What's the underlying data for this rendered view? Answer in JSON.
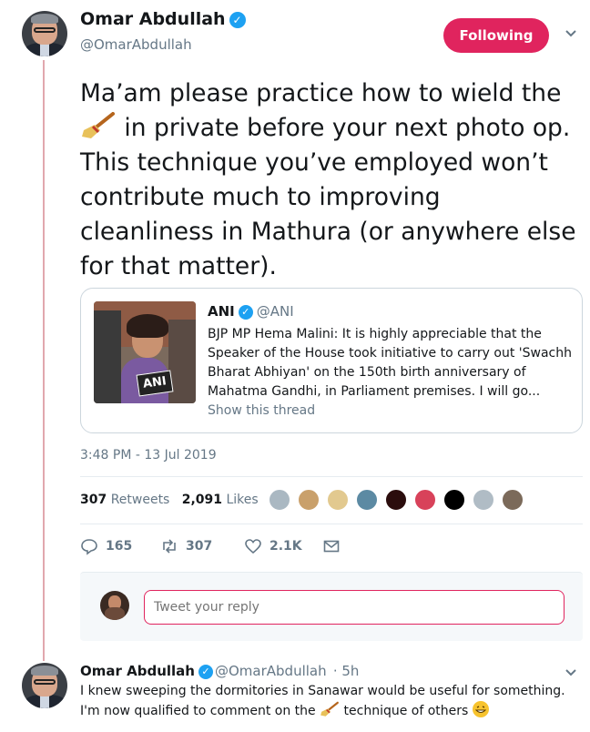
{
  "tweet": {
    "author_name": "Omar Abdullah",
    "author_handle": "@OmarAbdullah",
    "follow_label": "Following",
    "text_part1": "Ma’am please practice how to wield the",
    "text_part2": " in private before your next photo op. This technique you’ve employed won’t contribute much to improving cleanliness in Mathura (or anywhere else for that matter).",
    "timestamp": "3:48 PM - 13 Jul 2019",
    "retweets_count": "307",
    "retweets_label": "Retweets",
    "likes_count": "2,091",
    "likes_label": "Likes",
    "actions": {
      "replies": "165",
      "retweets": "307",
      "likes": "2.1K"
    }
  },
  "quoted": {
    "name": "ANI",
    "handle": "@ANI",
    "body": "BJP MP Hema Malini: It is highly appreciable that the Speaker of the House took initiative to carry out 'Swachh Bharat Abhiyan' on the 150th birth anniversary of Mahatma Gandhi, in Parliament premises. I will go...",
    "show_thread": "Show this thread",
    "image_text": "ANI"
  },
  "reply_box": {
    "placeholder": "Tweet your reply"
  },
  "reply": {
    "author_name": "Omar Abdullah",
    "author_handle": "@OmarAbdullah",
    "time": "· 5h",
    "text_part1": "I knew sweeping the dormitories in Sanawar would be useful for something. I'm now qualified to comment on the",
    "text_part2": " technique of others "
  },
  "colors": {
    "follow_button": "#e0245e",
    "verified": "#1da1f2",
    "thread_line": "#e1a8ae",
    "muted_text": "#657786"
  },
  "icons": [
    "verified-icon",
    "chevron-down-icon",
    "broom-emoji",
    "reply-icon",
    "retweet-icon",
    "like-icon",
    "message-icon",
    "grinning-emoji"
  ]
}
